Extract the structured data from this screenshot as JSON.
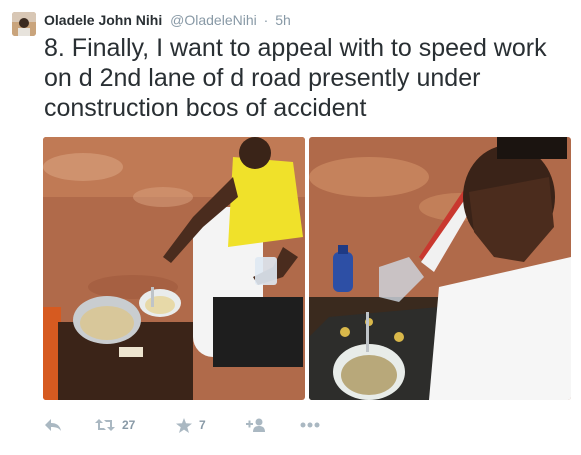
{
  "tweet": {
    "author_name": "Oladele John Nihi",
    "author_handle": "@OladeleNihi",
    "separator": "·",
    "time": "5h",
    "text": "8. Finally, I want to appeal with to speed work on d 2nd lane of d road presently under construction bcos of accident"
  },
  "actions": {
    "retweet_count": "27",
    "like_count": "7"
  },
  "icons": {
    "reply": "reply-icon",
    "retweet": "retweet-icon",
    "like": "star-icon",
    "follow": "follow-icon",
    "more": "more-icon"
  },
  "colors": {
    "icon": "#aab8c2",
    "meta": "#8899a6",
    "text": "#292f33"
  }
}
